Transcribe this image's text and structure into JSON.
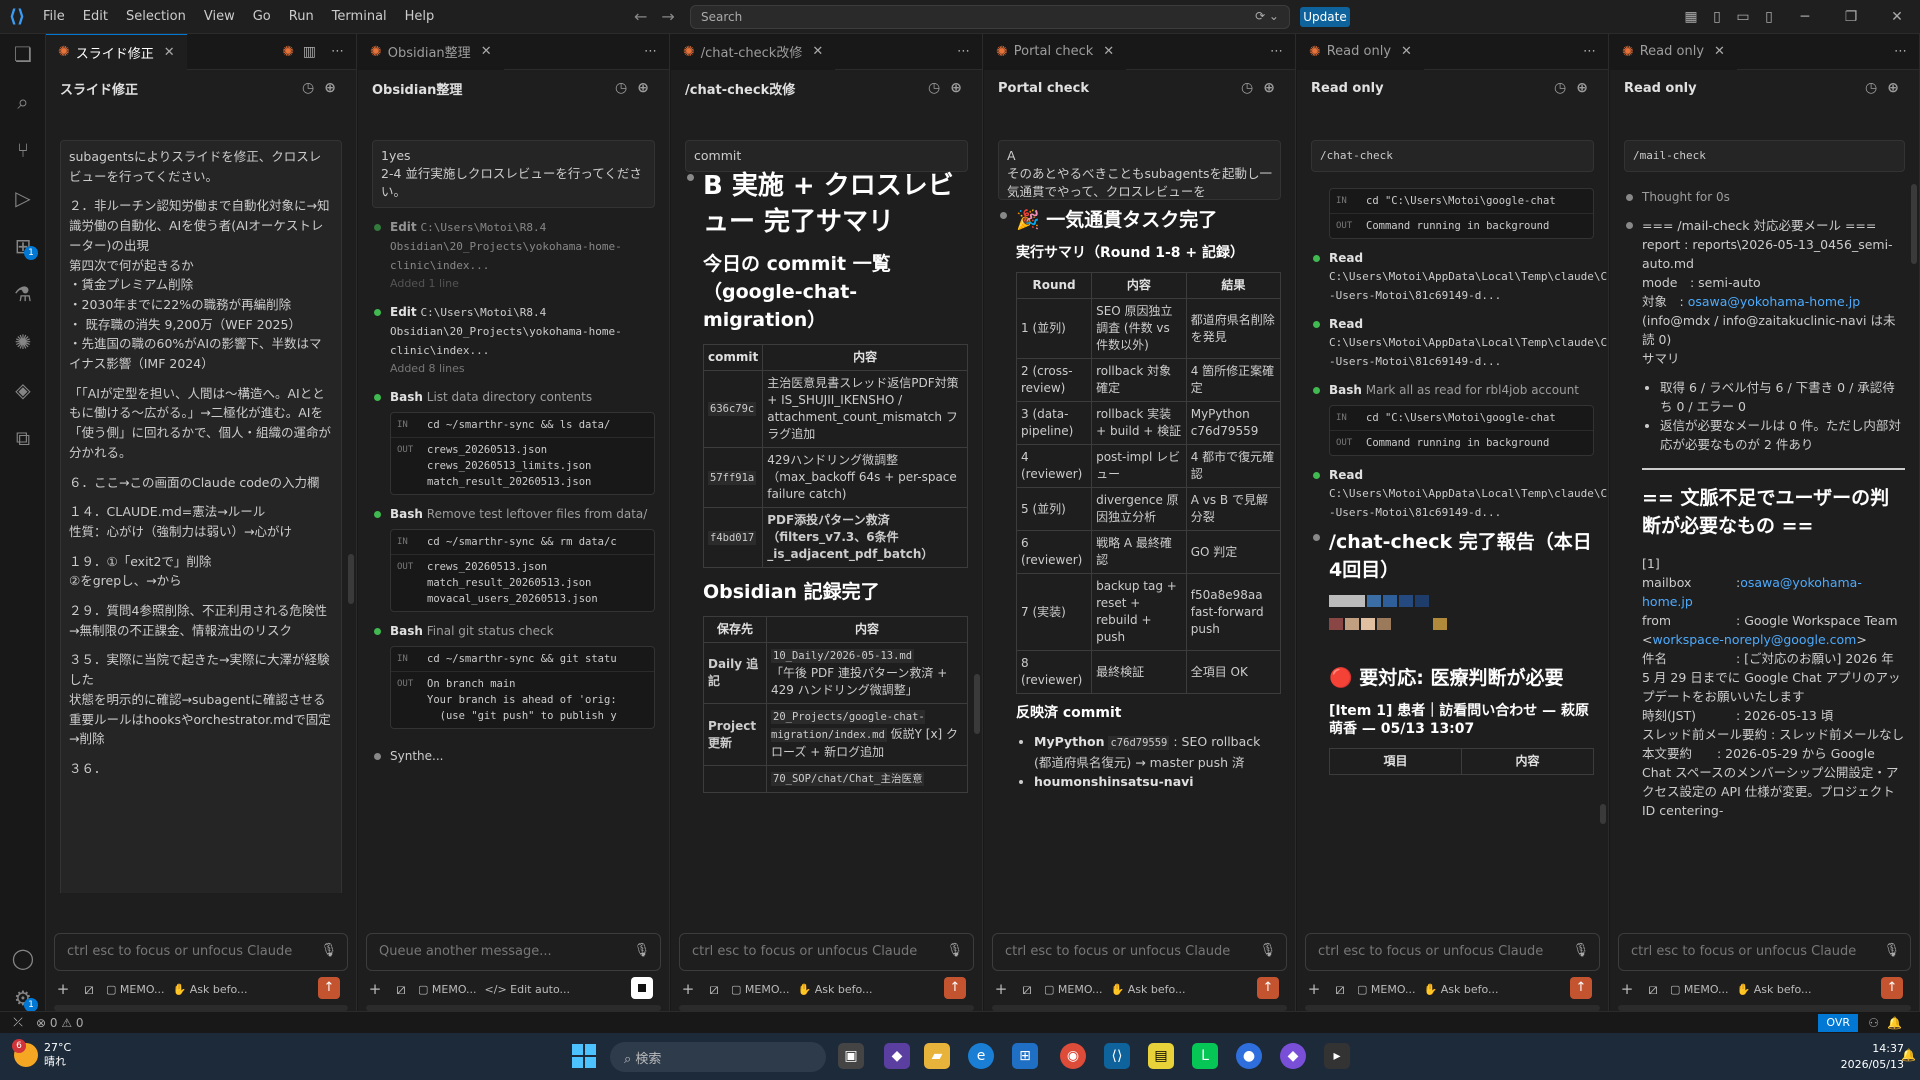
{
  "menu": [
    "File",
    "Edit",
    "Selection",
    "View",
    "Go",
    "Run",
    "Terminal",
    "Help"
  ],
  "search": {
    "placeholder": "Search"
  },
  "update_label": "Update",
  "panels": [
    {
      "tab": "スライド修正",
      "header": "スライド修正",
      "placeholder": "ctrl esc to focus or unfocus Claude",
      "tool_memo": "MEMO...",
      "tool_ask": "Ask befo..."
    },
    {
      "tab": "Obsidian整理",
      "header": "Obsidian整理",
      "placeholder": "Queue another message...",
      "tool_memo": "MEMO...",
      "tool_ask": "Edit auto..."
    },
    {
      "tab": "/chat-check改修",
      "header": "/chat-check改修",
      "placeholder": "ctrl esc to focus or unfocus Claude",
      "tool_memo": "MEMO...",
      "tool_ask": "Ask befo..."
    },
    {
      "tab": "Portal check",
      "header": "Portal check",
      "placeholder": "ctrl esc to focus or unfocus Claude",
      "tool_memo": "MEMO...",
      "tool_ask": "Ask befo..."
    },
    {
      "tab": "Read only",
      "header": "Read only",
      "placeholder": "ctrl esc to focus or unfocus Claude",
      "tool_memo": "MEMO...",
      "tool_ask": "Ask befo..."
    },
    {
      "tab": "Read only",
      "header": "Read only",
      "placeholder": "ctrl esc to focus or unfocus Claude",
      "tool_memo": "MEMO...",
      "tool_ask": "Ask befo..."
    }
  ],
  "p1": {
    "lines": [
      "subagentsによりスライドを修正、クロスレビューを行ってください。",
      "",
      "２．非ルーチン認知労働まで自動化対象に→知識労働の自動化、AIを使う者(AIオーケストレーター)の出現",
      "第四次で何が起きるか",
      "・賃金プレミアム削除",
      "・2030年までに22%の職務が再編削除",
      "・ 既存職の消失 9,200万（WEF 2025）",
      "・先進国の職の60%がAIの影響下、半数はマイナス影響（IMF 2024）",
      "",
      "「「AIが定型を担い、人間は〜構造へ。AIとともに働ける〜広がる。」→二極化が進む。AIを「使う側」に回れるかで、個人・組織の運命が分かれる。",
      "",
      "６．ここ→この画面のClaude codeの入力欄",
      "",
      "１４．CLAUDE.md=憲法→ルール",
      "性質：心がけ（強制力は弱い）→心がけ",
      "",
      "１９．①「exit2で」削除",
      "②をgrepし、→から",
      "",
      "２９．質問4参照削除、不正利用される危険性→無制限の不正課金、情報流出のリスク",
      "",
      "３５．実際に当院で起きた→実際に大澤が経験した",
      "状態を明示的に確認→subagentに確認させる",
      "重要ルールはhooksやorchestrator.mdで固定→削除",
      "",
      "３６．"
    ]
  },
  "p2": {
    "msg1": "1yes",
    "msg2": "2-4 並行実施しクロスレビューを行ってください。",
    "edit1_path": "C:\\Users\\Motoi\\R8.4 Obsidian\\20_Projects\\yokohama-home-clinic\\index...",
    "edit1_meta": "Added 1 line",
    "edit2_label": "Edit",
    "edit2_path": "C:\\Users\\Motoi\\R8.4 Obsidian\\20_Projects\\yokohama-home-clinic\\index...",
    "edit2_meta": "Added 8 lines",
    "bash1_label": "Bash",
    "bash1_desc": "List data directory contents",
    "bash1_in": "cd ~/smarthr-sync && ls data/",
    "bash1_out": "crews_20260513.json\ncrews_20260513_limits.json\nmatch_result_20260513.json",
    "bash2_label": "Bash",
    "bash2_desc": "Remove test leftover files from data/",
    "bash2_in": "cd ~/smarthr-sync && rm data/c",
    "bash2_out": "crews_20260513.json\nmatch_result_20260513.json\nmovacal_users_20260513.json",
    "bash3_label": "Bash",
    "bash3_desc": "Final git status check",
    "bash3_in": "cd ~/smarthr-sync && git statu",
    "bash3_out": "On branch main\nYour branch is ahead of 'orig:\n  (use \"git push\" to publish y",
    "synth": "Synthe...",
    "in_label": "IN",
    "out_label": "OUT"
  },
  "p3": {
    "msg": "commit",
    "h1": "B 実施 + クロスレビュー 完了サマリ",
    "h2a": "今日の commit 一覧（google-chat-migration）",
    "th_commit": "commit",
    "th_content": "内容",
    "rows": [
      {
        "c": "636c79c",
        "t": "主治医意見書スレッド返信PDF対策 + IS_SHUJII_IKENSHO / attachment_count_mismatch フラグ追加"
      },
      {
        "c": "57ff91a",
        "t": "429ハンドリング微調整（max_backoff 64s + per-space failure catch)"
      },
      {
        "c": "f4bd017",
        "t": "PDF添投パターン救済（filters_v7.3、6条件 _is_adjacent_pdf_batch）"
      }
    ],
    "h2b": "Obsidian 記録完了",
    "th_dest": "保存先",
    "rows2": [
      {
        "d": "Daily 追記",
        "code": "10_Daily/2026-05-13.md",
        "t": "「午後 PDF 連投パターン救済 + 429 ハンドリング微調整」"
      },
      {
        "d": "Project 更新",
        "code": "20_Projects/google-chat-migration/index.md",
        "t": "仮説Y [x] クローズ + 新ログ追加"
      },
      {
        "d": "",
        "code": "70_SOP/chat/Chat_主治医意",
        "t": ""
      }
    ]
  },
  "p4": {
    "msg1": "A",
    "msg2": "そのあとやるべきこともsubagentsを起動し一気通貫でやって、クロスレビューを",
    "h2": "🎉 一気通貫タスク完了",
    "h3a": "実行サマリ（Round 1-8 + 記録）",
    "th": [
      "Round",
      "内容",
      "結果"
    ],
    "rows": [
      [
        "1 (並列)",
        "SEO 原因独立調査 (件数 vs 件数以外)",
        "都道府県名削除を発見"
      ],
      [
        "2 (cross-review)",
        "rollback 対象確定",
        "4 箇所修正案確定"
      ],
      [
        "3 (data-pipeline)",
        "rollback 実装 + build + 検証",
        "MyPython c76d79559"
      ],
      [
        "4 (reviewer)",
        "post-impl レビュー",
        "4 都市で復元確認"
      ],
      [
        "5 (並列)",
        "divergence 原因独立分析",
        "A vs B で見解分裂"
      ],
      [
        "6 (reviewer)",
        "戦略 A 最終確認",
        "GO 判定"
      ],
      [
        "7 (実装)",
        "backup tag + reset + rebuild + push",
        "f50a8e98aa fast-forward push"
      ],
      [
        "8 (reviewer)",
        "最終検証",
        "全項目 OK"
      ]
    ],
    "h3b": "反映済 commit",
    "li1_b": "MyPython",
    "li1_code": "c76d79559",
    "li1_t": ": SEO rollback (都道府県名復元) → master push 済",
    "li2_b": "houmonshinsatsu-navi"
  },
  "p5": {
    "cmd": "/chat-check",
    "bash_in": "cd \"C:\\Users\\Motoi\\google-chat",
    "bash_out": "Command running in background",
    "read_label": "Read",
    "read1": "C:\\Users\\Motoi\\AppData\\Local\\Temp\\claude\\C--Users-Motoi\\81c69149-d...",
    "read2": "C:\\Users\\Motoi\\AppData\\Local\\Temp\\claude\\C--Users-Motoi\\81c69149-d...",
    "bash_label": "Bash",
    "bash_desc": "Mark all as read for rbl4job account",
    "bash2_in": "cd \"C:\\Users\\Motoi\\google-chat",
    "bash2_out": "Command running in background",
    "read3": "C:\\Users\\Motoi\\AppData\\Local\\Temp\\claude\\C--Users-Motoi\\81c69149-d...",
    "h2": "/chat-check 完了報告（本日4回目）",
    "red": "🔴 要対応: 医療判断が必要",
    "item": "[Item 1] 患者｜訪看問い合わせ — 萩原萌香 — 05/13 13:07",
    "th": [
      "項目",
      "内容"
    ]
  },
  "p6": {
    "cmd": "/mail-check",
    "thought": "Thought for 0s",
    "l1": "=== /mail-check 対応必要メール ===",
    "l2": "report : reports\\2026-05-13_0456_semi-auto.md",
    "l3": "mode　: semi-auto",
    "l4a": "対象　: ",
    "l4b": "osawa@yokohama-home.jp",
    "l5": "(info@mdx / info@zaitakuclinic-navi は未読 0)",
    "l6": "サマリ",
    "b1": "取得 6 / ラベル付与 6 / 下書き 0 / 承認待ち 0 / エラー 0",
    "b2": "返信が必要なメールは 0 件。ただし内部対応が必要なものが 2 件あり",
    "h2": "== 文脈不足でユーザーの判断が必要なもの ==",
    "n1": "[1]",
    "mb_k": "mailbox",
    "mb_v": "osawa@yokohama-home.jp",
    "from_k": "from",
    "from_v": "Google Workspace Team <",
    "from_link": "workspace-noreply@google.com",
    "subj_k": "件名",
    "subj_v": ": [ご対応のお願い] 2026 年 5 月 29 日までに Google Chat アプリのアップデートをお願いいたします",
    "time_k": "時刻(JST)",
    "time_v": ": 2026-05-13 頃",
    "thread": "スレッド前メール要約 : スレッド前メールなし",
    "body": "本文要約　　: 2026-05-29 から Google Chat スペースのメンバーシップ公開設定・アクセス設定の API 仕様が変更。プロジェクト ID centering-"
  },
  "status": {
    "errors": "0",
    "warnings": "0",
    "ovr": "OVR"
  },
  "taskbar": {
    "temp": "27°C",
    "weather": "晴れ",
    "search": "検索",
    "time": "14:37",
    "date": "2026/05/13",
    "badge": "6"
  },
  "colors": {
    "accent": "#0078d4",
    "send": "#c4532f",
    "success": "#3fb950",
    "link": "#4daafc"
  }
}
